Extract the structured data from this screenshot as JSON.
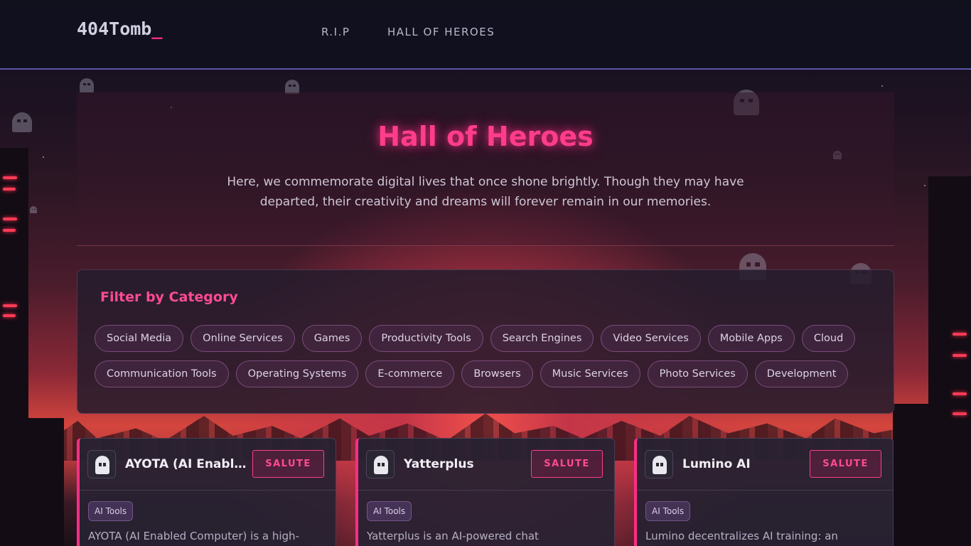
{
  "header": {
    "logo": "404Tomb",
    "logo_cursor": "_",
    "nav": [
      {
        "label": "R.I.P"
      },
      {
        "label": "HALL OF HEROES"
      }
    ]
  },
  "hero": {
    "title": "Hall of Heroes",
    "description": "Here, we commemorate digital lives that once shone brightly. Though they may have departed, their creativity and dreams will forever remain in our memories."
  },
  "filter": {
    "title": "Filter by Category",
    "row1": [
      "Social Media",
      "Online Services",
      "Games",
      "Productivity Tools",
      "Search Engines",
      "Video Services",
      "Mobile Apps",
      "Cloud"
    ],
    "row2": [
      "Communication Tools",
      "Operating Systems",
      "E-commerce",
      "Browsers",
      "Music Services",
      "Photo Services",
      "Development"
    ]
  },
  "cards": [
    {
      "name": "AYOTA (AI Enabled Computer)",
      "salute": "SALUTE",
      "tag": "AI Tools",
      "description": "AYOTA (AI Enabled Computer) is a high-"
    },
    {
      "name": "Yatterplus",
      "salute": "SALUTE",
      "tag": "AI Tools",
      "description": "Yatterplus is an AI-powered chat"
    },
    {
      "name": "Lumino AI",
      "salute": "SALUTE",
      "tag": "AI Tools",
      "description": "Lumino decentralizes AI training: an"
    }
  ],
  "colors": {
    "accent": "#ff2d87",
    "header_border": "#5a55a8",
    "header_bg": "#12111e"
  }
}
